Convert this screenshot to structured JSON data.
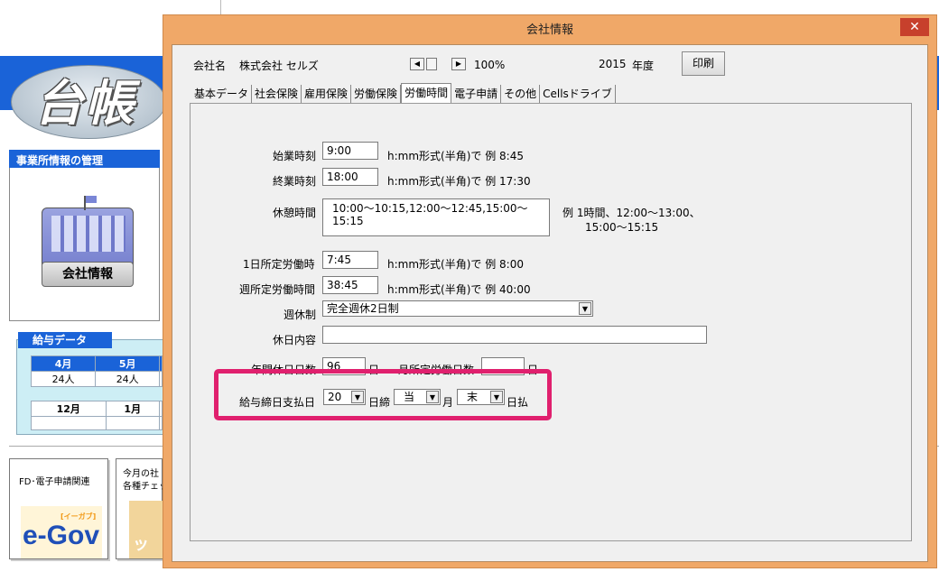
{
  "background_app": {
    "logo_text": "台帳",
    "office_panel": {
      "heading": "事業所情報の管理",
      "button_label": "会社情報"
    },
    "payroll_panel": {
      "heading": "給与データ",
      "row1": [
        {
          "month": "4月",
          "count": "24人"
        },
        {
          "month": "5月",
          "count": "24人"
        }
      ],
      "row2": [
        {
          "month": "12月",
          "count": ""
        },
        {
          "month": "1月",
          "count": ""
        }
      ]
    },
    "tiles": [
      {
        "label": "FD･電子申請関連",
        "image_text": "e-Gov",
        "image_subtext": "[イーガブ]"
      },
      {
        "label": "今月の社\n各種チェッ",
        "image_text": "ッ"
      }
    ]
  },
  "dialog": {
    "title": "会社情報",
    "close_label": "✕",
    "company_name_label": "会社名",
    "company_name_value": "株式会社 セルズ",
    "zoom": "100%",
    "year": "2015",
    "year_label": "年度",
    "print_label": "印刷",
    "tabs": [
      {
        "label": "基本データ",
        "active": false
      },
      {
        "label": "社会保険",
        "active": false
      },
      {
        "label": "雇用保険",
        "active": false
      },
      {
        "label": "労働保険",
        "active": false
      },
      {
        "label": "労働時間",
        "active": true
      },
      {
        "label": "電子申請",
        "active": false
      },
      {
        "label": "その他",
        "active": false
      },
      {
        "label": "Cellsドライブ",
        "active": false
      }
    ],
    "form": {
      "start_time": {
        "label": "始業時刻",
        "value": "9:00",
        "hint": "h:mm形式(半角)で  例  8:45"
      },
      "end_time": {
        "label": "終業時刻",
        "value": "18:00",
        "hint": "h:mm形式(半角)で  例  17:30"
      },
      "break_time": {
        "label": "休憩時間",
        "value": "10:00～10:15,12:00～12:45,15:00～15:15",
        "hint_line1": "例  1時間、12:00～13:00、",
        "hint_line2": "15:00～15:15"
      },
      "daily_hours": {
        "label": "1日所定労働時",
        "value": "7:45",
        "hint": "h:mm形式(半角)で  例  8:00"
      },
      "weekly_hours": {
        "label": "週所定労働時間",
        "value": "38:45",
        "hint": "h:mm形式(半角)で  例  40:00"
      },
      "weekly_holiday": {
        "label": "週休制",
        "value": "完全週休2日制"
      },
      "holiday_content": {
        "label": "休日内容",
        "value": ""
      },
      "annual_holidays": {
        "label": "年間休日日数",
        "value": "96",
        "unit": "日"
      },
      "monthly_days": {
        "label": "月所定労働日数",
        "value": "",
        "unit": "日"
      },
      "pay_dates": {
        "label": "給与締日支払日",
        "cutoff_day": "20",
        "cutoff_suffix": "日締",
        "pay_month": "当",
        "month_suffix": "月",
        "pay_day": "末",
        "pay_suffix": "日払"
      }
    }
  },
  "colors": {
    "highlight": "#e0206e",
    "dialog_frame": "#f0a868",
    "app_blue": "#1a63d8"
  }
}
